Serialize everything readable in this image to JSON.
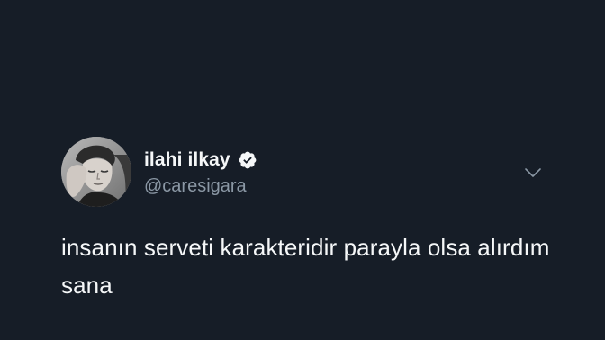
{
  "tweet": {
    "author": {
      "display_name": "ilahi ilkay",
      "handle": "@caresigara",
      "verified": true,
      "avatar_icon": "profile-photo"
    },
    "text": "insanın serveti karakteridir parayla olsa alırdım sana",
    "menu_icon": "chevron-down-icon"
  },
  "colors": {
    "background": "#161d27",
    "primary_text": "#f5f7f8",
    "secondary_text": "#8b98a5",
    "verified_badge": "#f5f7f8"
  }
}
